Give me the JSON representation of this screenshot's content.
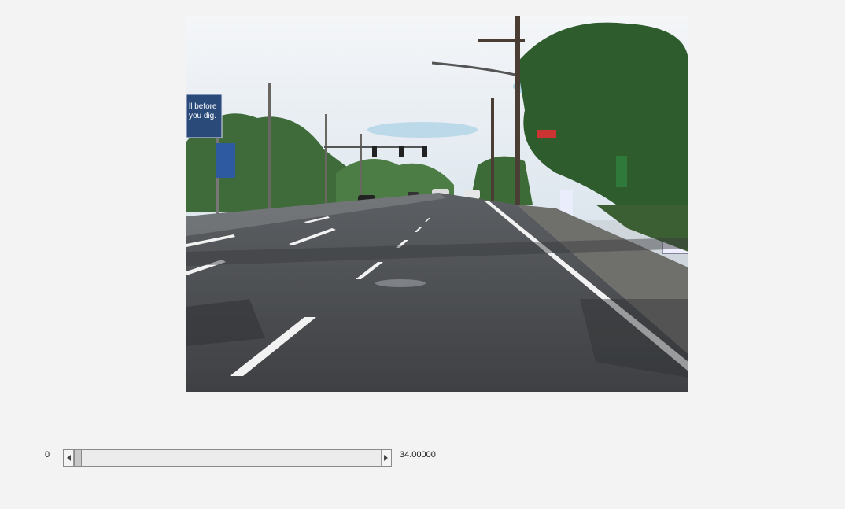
{
  "video": {
    "scene_description": "",
    "billboard_text": "ll before you dig."
  },
  "slider": {
    "min_label": "0",
    "max_label": "34.00000",
    "min": 0,
    "max": 34,
    "value": 0
  },
  "icons": {
    "left_arrow": "triangle-left-icon",
    "right_arrow": "triangle-right-icon"
  },
  "colors": {
    "background": "#f3f3f3",
    "road": "#4a4c4f",
    "lane_marking": "#f2f2f2"
  }
}
